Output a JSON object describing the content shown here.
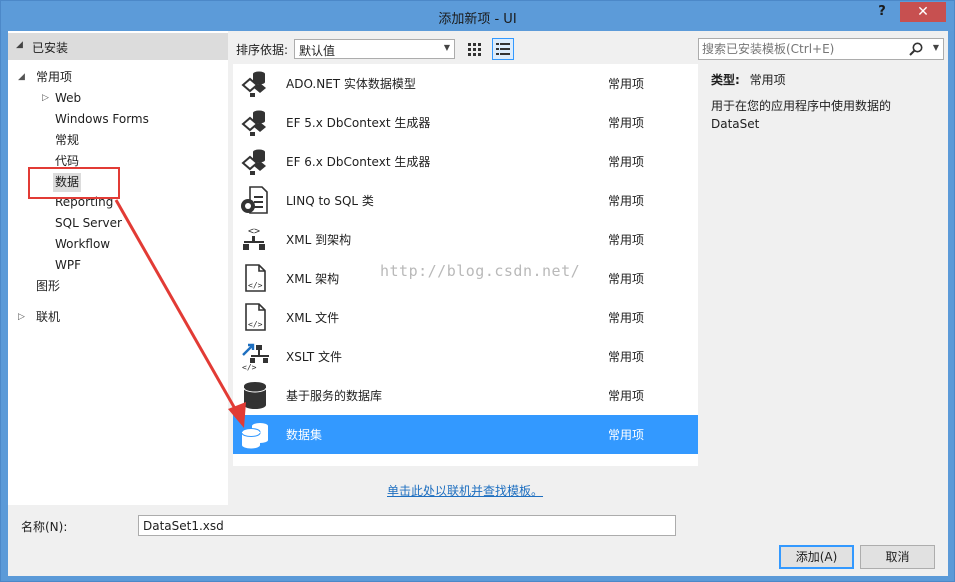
{
  "window": {
    "title": "添加新项 - UI",
    "help_label": "?",
    "close_label": "✕"
  },
  "left": {
    "installed_label": "已安装",
    "tree": [
      {
        "label": "常用项",
        "toggle": "◢",
        "level": 0
      },
      {
        "label": "Web",
        "toggle": "▷",
        "level": 1
      },
      {
        "label": "Windows Forms",
        "level": 1
      },
      {
        "label": "常规",
        "level": 1
      },
      {
        "label": "代码",
        "level": 1
      },
      {
        "label": "数据",
        "level": 1,
        "selected": true
      },
      {
        "label": "Reporting",
        "level": 1
      },
      {
        "label": "SQL Server",
        "level": 1
      },
      {
        "label": "Workflow",
        "level": 1
      },
      {
        "label": "WPF",
        "level": 1
      },
      {
        "label": "图形",
        "level": 0
      },
      {
        "label": "联机",
        "toggle": "▷",
        "level": 0
      }
    ]
  },
  "sort": {
    "label": "排序依据:",
    "value": "默认值"
  },
  "templates": [
    {
      "name": "ADO.NET 实体数据模型",
      "category": "常用项",
      "icon": "entity-model-icon"
    },
    {
      "name": "EF 5.x DbContext 生成器",
      "category": "常用项",
      "icon": "dbcontext-generator-icon"
    },
    {
      "name": "EF 6.x DbContext 生成器",
      "category": "常用项",
      "icon": "dbcontext-generator-icon"
    },
    {
      "name": "LINQ to SQL 类",
      "category": "常用项",
      "icon": "linq-to-sql-icon"
    },
    {
      "name": "XML 到架构",
      "category": "常用项",
      "icon": "xml-to-schema-icon"
    },
    {
      "name": "XML 架构",
      "category": "常用项",
      "icon": "xml-schema-icon"
    },
    {
      "name": "XML 文件",
      "category": "常用项",
      "icon": "xml-file-icon"
    },
    {
      "name": "XSLT 文件",
      "category": "常用项",
      "icon": "xslt-file-icon"
    },
    {
      "name": "基于服务的数据库",
      "category": "常用项",
      "icon": "database-icon"
    },
    {
      "name": "数据集",
      "category": "常用项",
      "icon": "dataset-icon",
      "selected": true
    }
  ],
  "online_link": "单击此处以联机并查找模板。",
  "search": {
    "placeholder": "搜索已安装模板(Ctrl+E)"
  },
  "details": {
    "type_label": "类型:",
    "type_value": "常用项",
    "description": "用于在您的应用程序中使用数据的 DataSet"
  },
  "watermark": "http://blog.csdn.net/",
  "name_field": {
    "label": "名称(N):",
    "value": "DataSet1.xsd"
  },
  "buttons": {
    "add": "添加(A)",
    "cancel": "取消"
  },
  "colors": {
    "titlebar": "#5c9bd9",
    "selection": "#3399ff",
    "annotation": "#e23b35",
    "link": "#1e6fc0"
  }
}
